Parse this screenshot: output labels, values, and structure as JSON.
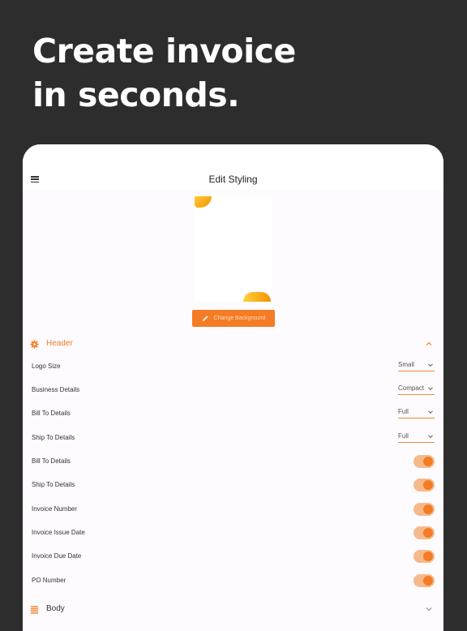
{
  "headline": {
    "line1": "Create invoice",
    "line2": "in seconds."
  },
  "topbar": {
    "title": "Edit Styling",
    "menu_icon": "hamburger-menu-icon"
  },
  "preview": {
    "button_label": "Change Background",
    "button_icon": "pencil-icon"
  },
  "colors": {
    "accent": "#f47c24",
    "toggle_track": "#f6b98c",
    "background": "#2d2d2d",
    "panel": "#fdfbfd"
  },
  "header_section": {
    "title": "Header",
    "icon": "gear-icon",
    "expanded": true,
    "selects": [
      {
        "label": "Logo Size",
        "value": "Small"
      },
      {
        "label": "Business Details",
        "value": "Compact"
      },
      {
        "label": "Bill To Details",
        "value": "Full"
      },
      {
        "label": "Ship To Details",
        "value": "Full"
      }
    ],
    "toggles": [
      {
        "label": "Bill To Details",
        "on": true
      },
      {
        "label": "Ship To Details",
        "on": true
      },
      {
        "label": "Invoice Number",
        "on": true
      },
      {
        "label": "Invoice Issue Date",
        "on": true
      },
      {
        "label": "Invoice Due Date",
        "on": true
      },
      {
        "label": "PO Number",
        "on": true
      }
    ]
  },
  "body_section": {
    "title": "Body",
    "icon": "list-icon",
    "expanded": false
  }
}
